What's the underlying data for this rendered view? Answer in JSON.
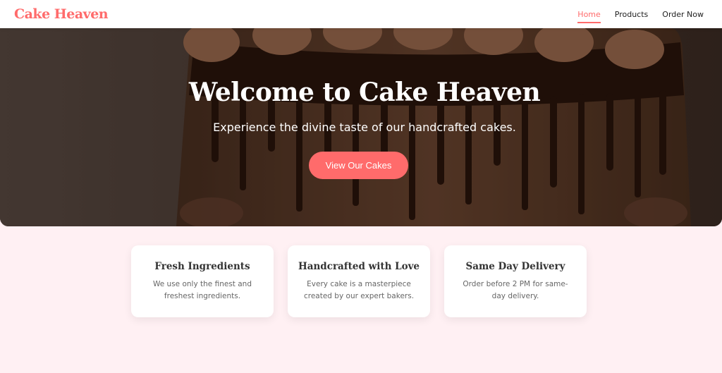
{
  "header": {
    "logo": "Cake Heaven",
    "nav": [
      {
        "label": "Home",
        "active": true
      },
      {
        "label": "Products",
        "active": false
      },
      {
        "label": "Order Now",
        "active": false
      }
    ]
  },
  "hero": {
    "title": "Welcome to Cake Heaven",
    "subtitle": "Experience the divine taste of our handcrafted cakes.",
    "cta_label": "View Our Cakes"
  },
  "features": [
    {
      "title": "Fresh Ingredients",
      "text": "We use only the finest and freshest ingredients."
    },
    {
      "title": "Handcrafted with Love",
      "text": "Every cake is a masterpiece created by our expert bakers."
    },
    {
      "title": "Same Day Delivery",
      "text": "Order before 2 PM for same-day delivery."
    }
  ],
  "colors": {
    "accent": "#ff6b6b",
    "page_background": "#fff0f3"
  }
}
